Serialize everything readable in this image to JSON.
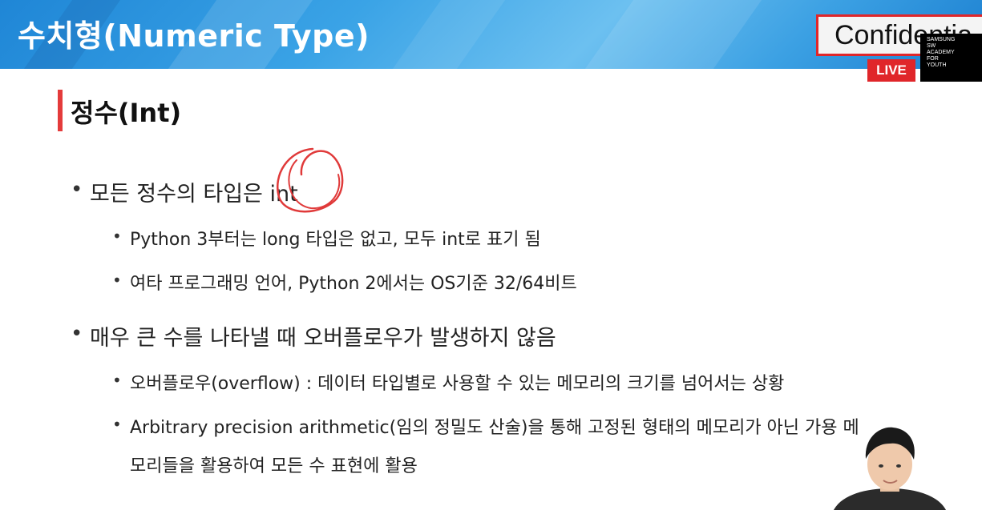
{
  "header": {
    "title": "수치형(Numeric Type)",
    "confidential": "Confidentia",
    "live": "LIVE",
    "logo_lines": [
      "SAMSUNG",
      "SW",
      "ACADEMY",
      "FOR",
      "YOUTH"
    ]
  },
  "section": {
    "title": "정수(Int)"
  },
  "bullets": [
    {
      "text": "모든 정수의 타입은 int",
      "subs": [
        "Python 3부터는 long 타입은 없고, 모두 int로 표기 됨",
        "여타 프로그래밍 언어, Python 2에서는 OS기준 32/64비트"
      ]
    },
    {
      "text": "매우 큰 수를 나타낼 때 오버플로우가 발생하지 않음",
      "subs": [
        "오버플로우(overflow) : 데이터 타입별로 사용할 수 있는 메모리의 크기를 넘어서는 상황",
        "Arbitrary precision arithmetic(임의 정밀도 산술)을 통해 고정된 형태의 메모리가 아닌 가용 메",
        "모리들을 활용하여 모든 수 표현에 활용"
      ]
    }
  ],
  "colors": {
    "header_blue": "#2a93dc",
    "accent_red": "#e0262a",
    "annotation_red": "#e03a3a"
  }
}
